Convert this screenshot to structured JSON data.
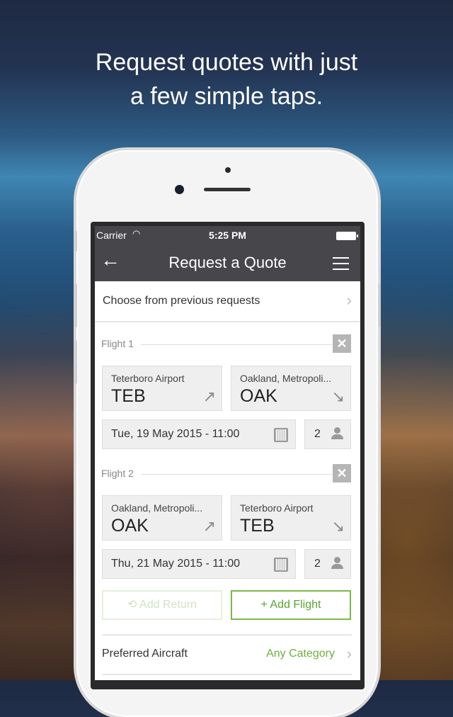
{
  "headline": {
    "line1": "Request quotes with just",
    "line2": "a few simple taps."
  },
  "status_bar": {
    "carrier": "Carrier",
    "wifi_icon": "wifi-icon",
    "time": "5:25 PM",
    "battery_icon": "battery-icon"
  },
  "nav": {
    "back_icon": "←",
    "title": "Request a Quote",
    "menu_icon": "hamburger-icon"
  },
  "previous": {
    "label": "Choose from previous requests",
    "chevron": "›"
  },
  "flights": [
    {
      "label": "Flight 1",
      "remove": "✕",
      "from": {
        "name": "Teterboro Airport",
        "code": "TEB",
        "arrow": "↗"
      },
      "to": {
        "name": "Oakland, Metropoli...",
        "code": "OAK",
        "arrow": "↘"
      },
      "date": "Tue, 19 May 2015 - 11:00",
      "passengers": "2"
    },
    {
      "label": "Flight 2",
      "remove": "✕",
      "from": {
        "name": "Oakland, Metropoli...",
        "code": "OAK",
        "arrow": "↗"
      },
      "to": {
        "name": "Teterboro Airport",
        "code": "TEB",
        "arrow": "↘"
      },
      "date": "Thu, 21 May 2015 - 11:00",
      "passengers": "2"
    }
  ],
  "actions": {
    "add_return": "⟲  Add Return",
    "add_flight": "+  Add Flight"
  },
  "preferred": {
    "label": "Preferred Aircraft",
    "value": "Any Category",
    "chevron": "›"
  },
  "colors": {
    "accent_green": "#6fae3e",
    "navbar": "#47474b"
  }
}
